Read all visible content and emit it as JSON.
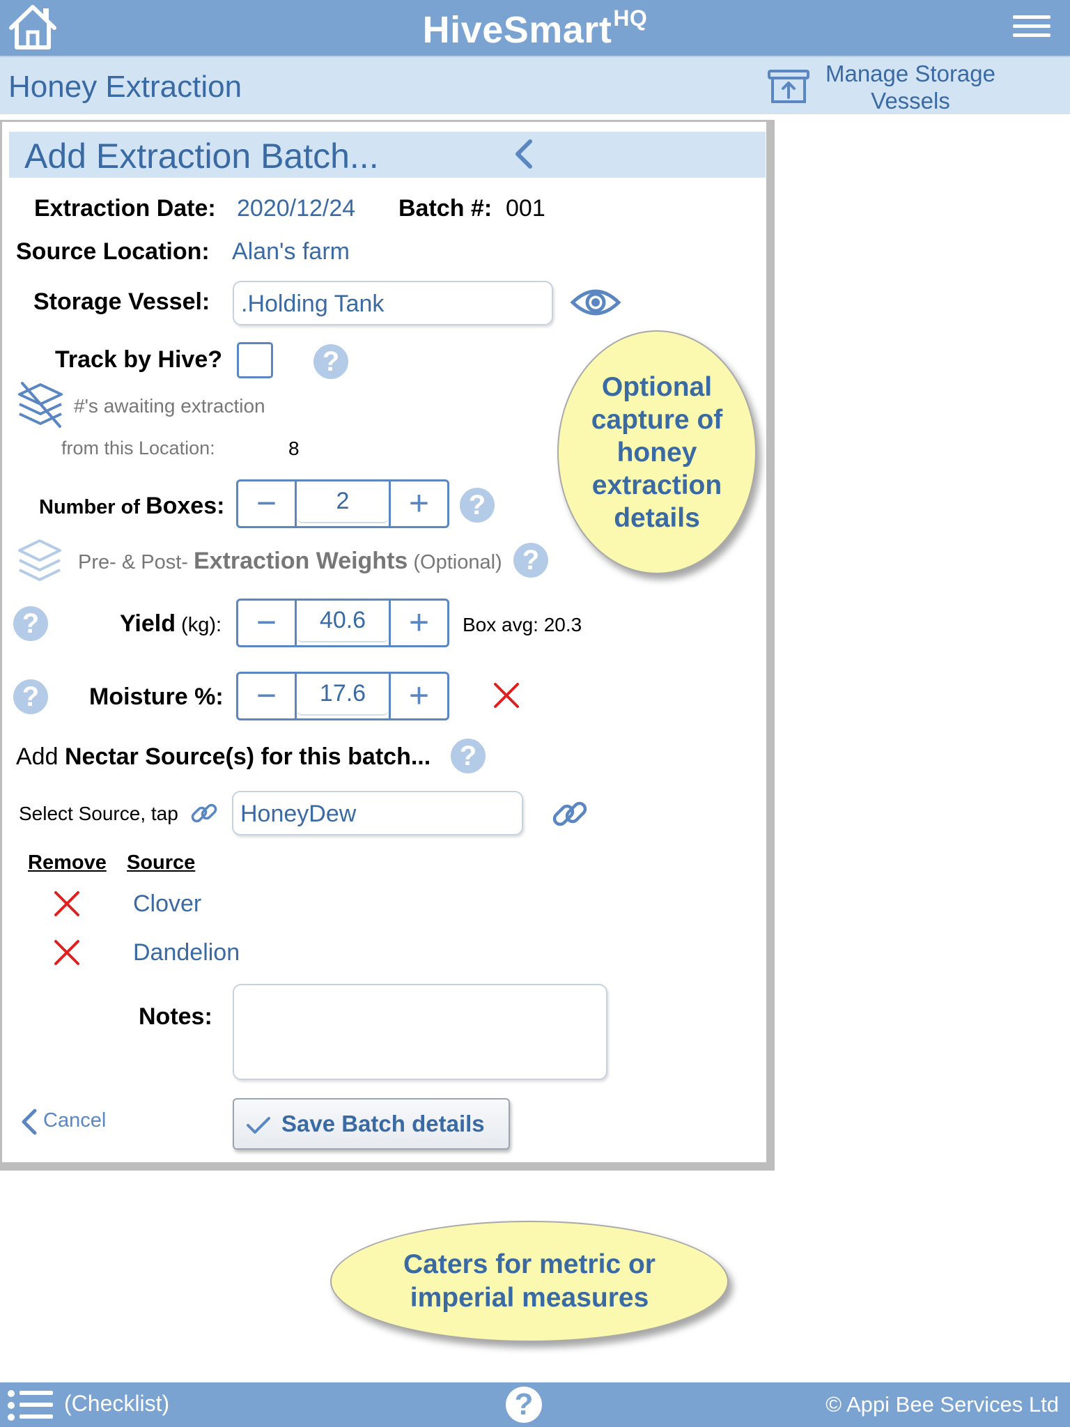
{
  "header": {
    "app_name": "HiveSmart",
    "app_superscript": "HQ",
    "home_icon": "home-icon",
    "menu_icon": "hamburger-menu-icon"
  },
  "subheader": {
    "section_title": "Honey Extraction",
    "storage_link_line1": "Manage Storage",
    "storage_link_line2": "Vessels",
    "storage_icon": "storage-box-upload-icon"
  },
  "panel": {
    "title": "Add Extraction Batch...",
    "back_icon": "chevron-left-icon",
    "extraction_date_label": "Extraction Date:",
    "extraction_date_value": "2020/12/24",
    "batch_label": "Batch #:",
    "batch_value": "001",
    "source_location_label": "Source Location:",
    "source_location_value": "Alan's farm",
    "storage_vessel_label": "Storage Vessel:",
    "storage_vessel_value": ".Holding Tank",
    "track_by_hive_label": "Track by Hive?",
    "track_by_hive_checked": false,
    "awaiting_text": "#'s awaiting extraction",
    "from_location_label": "from this Location:",
    "from_location_value": "8",
    "boxes_label_prefix": "Number of ",
    "boxes_label_main": "Boxes",
    "boxes_label_suffix": ":",
    "boxes_value": "2",
    "weights_prefix": "Pre- & Post- ",
    "weights_main": "Extraction Weights",
    "weights_suffix": " (Optional)",
    "yield_label": "Yield",
    "yield_unit": " (kg):",
    "yield_value": "40.6",
    "box_avg": "Box avg: 20.3",
    "moisture_label": "Moisture %:",
    "moisture_value": "17.6",
    "nectar_prefix": "Add ",
    "nectar_main": "Nectar Source(s) for this batch...",
    "select_source_label": "Select Source, tap",
    "select_source_value": "HoneyDew",
    "col_remove": "Remove",
    "col_source": "Source",
    "sources": [
      "Clover",
      "Dandelion"
    ],
    "notes_label": "Notes:",
    "notes_value": "",
    "cancel_label": "Cancel",
    "save_label": "Save Batch details",
    "help_glyph": "?",
    "minus_glyph": "−",
    "plus_glyph": "+"
  },
  "callouts": {
    "optional_capture": "Optional capture of honey extraction details",
    "metric_imperial": "Caters for metric or imperial measures"
  },
  "footer": {
    "checklist_label": "(Checklist)",
    "help_glyph": "?",
    "copyright": "© Appi Bee Services Ltd"
  },
  "colors": {
    "top_bar": "#7aa3d2",
    "sub_header": "#d2e4f3",
    "accent_text": "#3a6aa4",
    "stepper_border": "#5a87c2",
    "callout_fill": "#fbf8b0",
    "remove_red": "#e02020"
  }
}
